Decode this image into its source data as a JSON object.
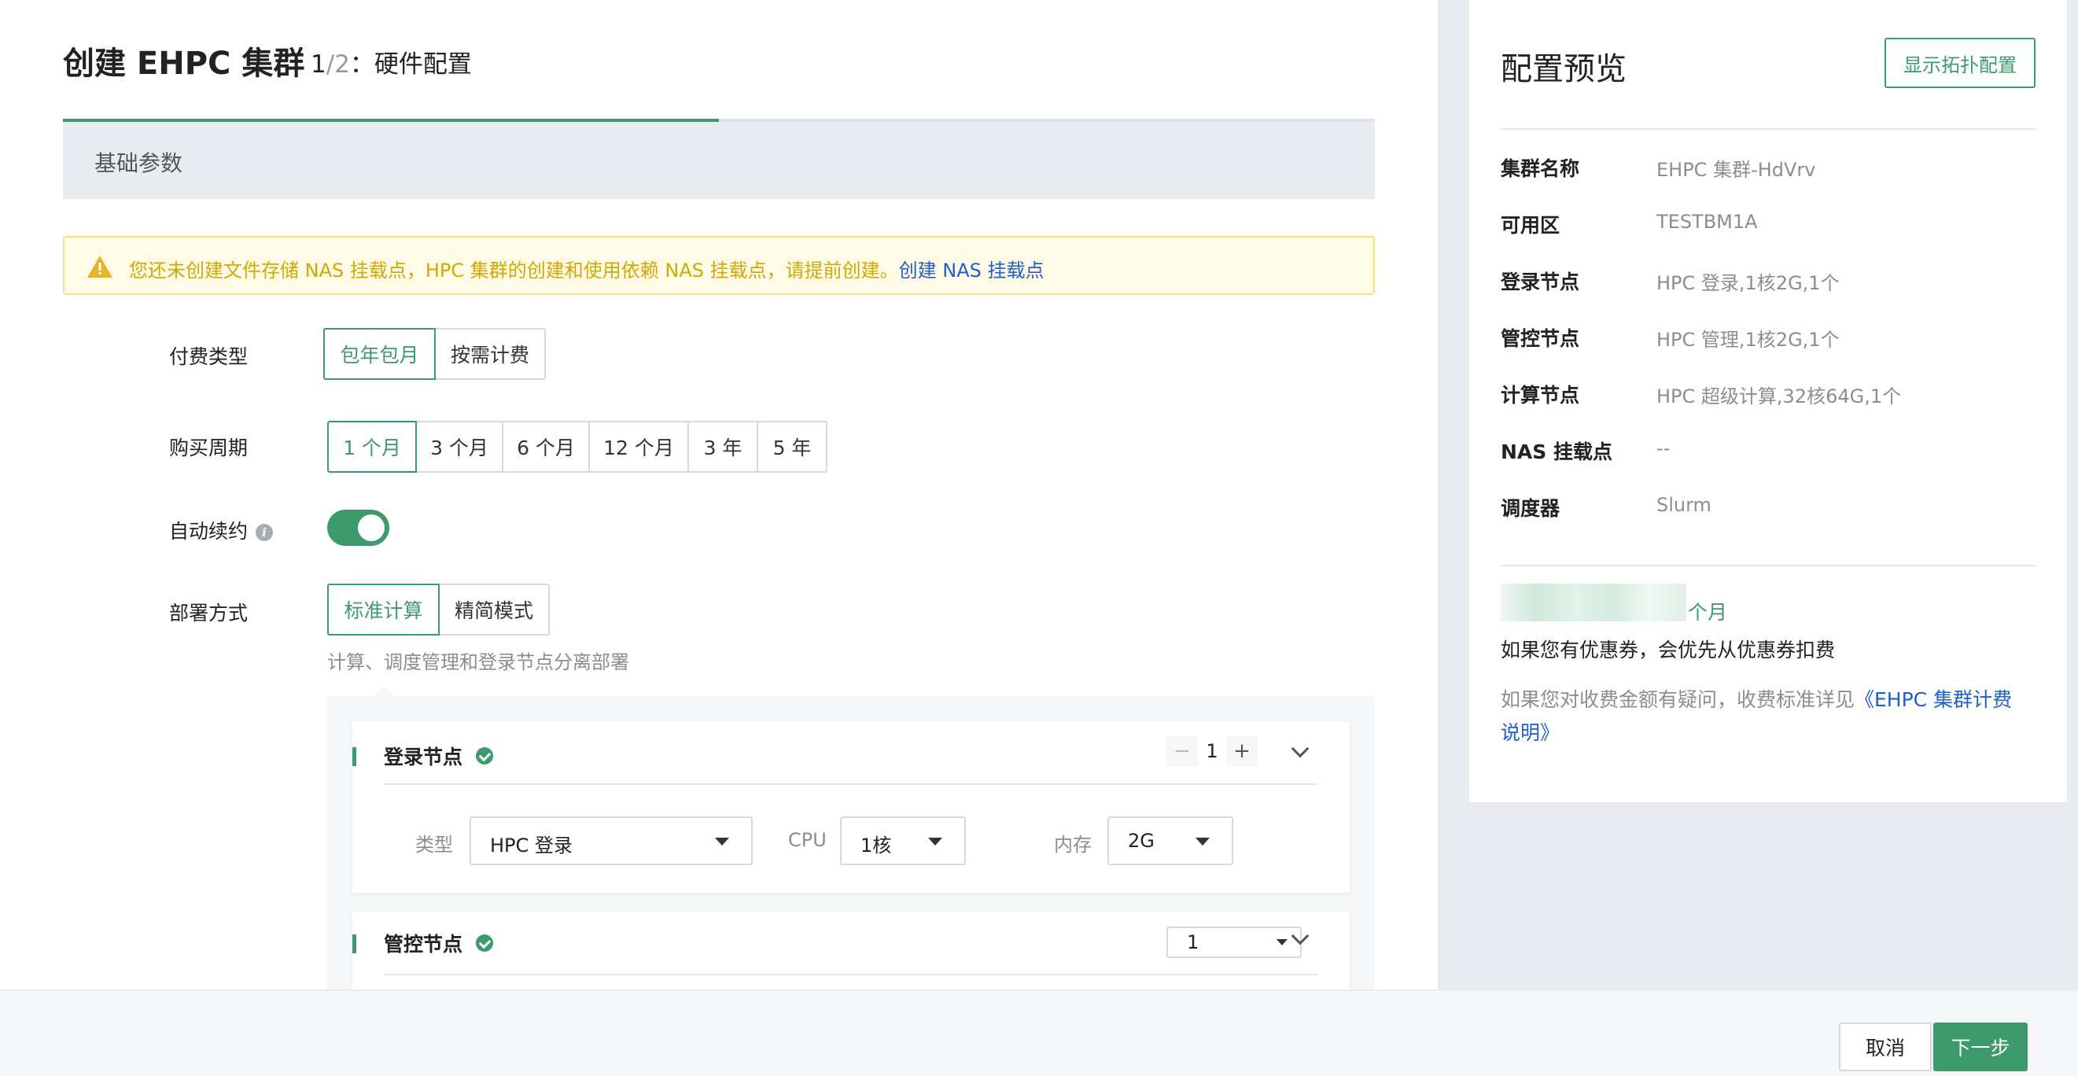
{
  "header": {
    "title": "创建 EHPC 集群",
    "step_current": "1",
    "step_separator": "/",
    "step_total": "2",
    "step_name": "：硬件配置"
  },
  "section": {
    "title": "基础参数"
  },
  "alert": {
    "icon": "warning-icon",
    "message": "您还未创建文件存储 NAS 挂载点，HPC 集群的创建和使用依赖 NAS 挂载点，请提前创建。",
    "link": "创建 NAS 挂载点"
  },
  "form": {
    "payment": {
      "label": "付费类型",
      "options": [
        "包年包月",
        "按需计费"
      ],
      "selected": "包年包月"
    },
    "period": {
      "label": "购买周期",
      "options": [
        "1 个月",
        "3 个月",
        "6 个月",
        "12 个月",
        "3 年",
        "5 年"
      ],
      "selected": "1 个月"
    },
    "auto_renew": {
      "label": "自动续约",
      "info_icon": "info-icon",
      "enabled": true
    },
    "deploy": {
      "label": "部署方式",
      "options": [
        "标准计算",
        "精简模式"
      ],
      "selected": "标准计算",
      "hint": "计算、调度管理和登录节点分离部署"
    }
  },
  "nodes": [
    {
      "title": "登录节点",
      "count": "1",
      "minus": "−",
      "plus": "+",
      "type_label": "类型",
      "type_value": "HPC 登录",
      "cpu_label": "CPU",
      "cpu_value": "1核",
      "mem_label": "内存",
      "mem_value": "2G"
    },
    {
      "title": "管控节点",
      "count": "1"
    }
  ],
  "summary": {
    "title": "配置预览",
    "topology_button": "显示拓扑配置",
    "rows": [
      {
        "label": "集群名称",
        "value": "EHPC 集群-HdVrv"
      },
      {
        "label": "可用区",
        "value": "TESTBM1A"
      },
      {
        "label": "登录节点",
        "value": "HPC 登录,1核2G,1个"
      },
      {
        "label": "管控节点",
        "value": "HPC 管理,1核2G,1个"
      },
      {
        "label": "计算节点",
        "value": "HPC 超级计算,32核64G,1个"
      },
      {
        "label": "NAS 挂载点",
        "value": "--"
      },
      {
        "label": "调度器",
        "value": "Slurm"
      }
    ],
    "price_unit": "个月",
    "coupon_note": "如果您有优惠券，会优先从优惠券扣费",
    "billing_prefix": "如果您对收费金额有疑问，收费标准详见",
    "billing_link": "《EHPC 集群计费说明》"
  },
  "footer": {
    "cancel": "取消",
    "next": "下一步"
  },
  "colors": {
    "primary": "#3c9a6c",
    "warning": "#d4a800",
    "link": "#1f5fc9",
    "panel_bg": "#e8ecf1"
  }
}
